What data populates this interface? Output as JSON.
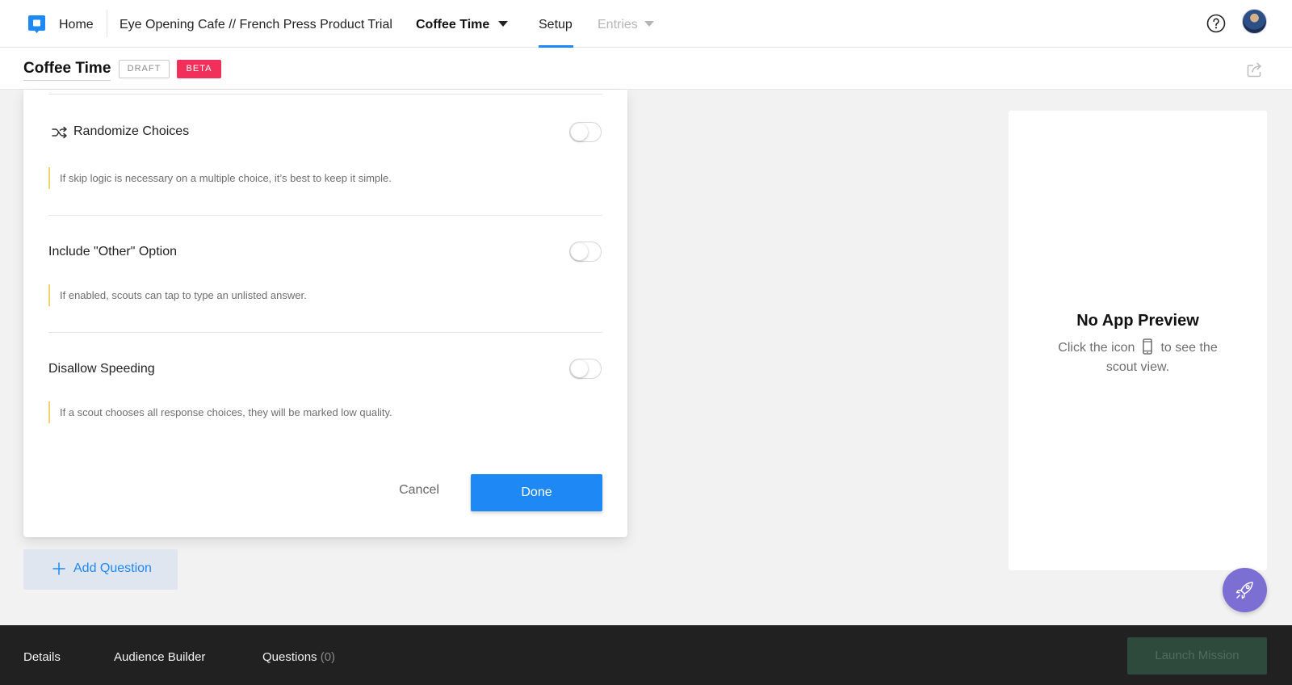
{
  "nav": {
    "home": "Home",
    "breadcrumb": "Eye Opening Cafe // French Press Product Trial",
    "mission": "Coffee Time",
    "setup": "Setup",
    "entries": "Entries"
  },
  "header": {
    "title": "Coffee Time",
    "draft_badge": "DRAFT",
    "beta_badge": "BETA"
  },
  "options": [
    {
      "label": "Randomize Choices",
      "hint": "If skip logic is necessary on a multiple choice, it’s best to keep it simple.",
      "enabled": false
    },
    {
      "label": "Include \"Other\" Option",
      "hint": "If enabled, scouts can tap to type an unlisted answer.",
      "enabled": false
    },
    {
      "label": "Disallow Speeding",
      "hint": "If a scout chooses all response choices, they will be marked low quality.",
      "enabled": false
    }
  ],
  "dialog": {
    "cancel": "Cancel",
    "done": "Done"
  },
  "add_question": "Add Question",
  "preview": {
    "title": "No App Preview",
    "line1_pre": "Click the icon",
    "line1_post": "to see the",
    "line2": "scout view."
  },
  "footer": {
    "details": "Details",
    "audience": "Audience Builder",
    "questions": "Questions",
    "questions_count": "(0)",
    "launch": "Launch Mission"
  },
  "colors": {
    "accent": "#1e88f5",
    "beta": "#f0305a",
    "fab": "#7b6fd3",
    "footer": "#212121"
  },
  "icons": [
    "app-logo-icon",
    "caret-down-icon",
    "help-icon",
    "share-icon",
    "shuffle-icon",
    "plus-icon",
    "phone-icon",
    "rocket-icon"
  ]
}
